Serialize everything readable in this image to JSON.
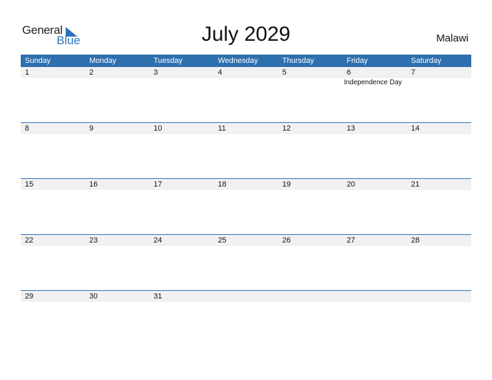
{
  "logo": {
    "general": "General",
    "blue": "Blue"
  },
  "title": "July 2029",
  "country": "Malawi",
  "colors": {
    "accent": "#2e6fae",
    "strip": "#f1f1f1",
    "logo_blue": "#2a73b8"
  },
  "weekdays": [
    "Sunday",
    "Monday",
    "Tuesday",
    "Wednesday",
    "Thursday",
    "Friday",
    "Saturday"
  ],
  "weeks": [
    [
      {
        "day": "1"
      },
      {
        "day": "2"
      },
      {
        "day": "3"
      },
      {
        "day": "4"
      },
      {
        "day": "5"
      },
      {
        "day": "6",
        "holiday": "Independence Day"
      },
      {
        "day": "7"
      }
    ],
    [
      {
        "day": "8"
      },
      {
        "day": "9"
      },
      {
        "day": "10"
      },
      {
        "day": "11"
      },
      {
        "day": "12"
      },
      {
        "day": "13"
      },
      {
        "day": "14"
      }
    ],
    [
      {
        "day": "15"
      },
      {
        "day": "16"
      },
      {
        "day": "17"
      },
      {
        "day": "18"
      },
      {
        "day": "19"
      },
      {
        "day": "20"
      },
      {
        "day": "21"
      }
    ],
    [
      {
        "day": "22"
      },
      {
        "day": "23"
      },
      {
        "day": "24"
      },
      {
        "day": "25"
      },
      {
        "day": "26"
      },
      {
        "day": "27"
      },
      {
        "day": "28"
      }
    ],
    [
      {
        "day": "29"
      },
      {
        "day": "30"
      },
      {
        "day": "31"
      },
      {
        "day": ""
      },
      {
        "day": ""
      },
      {
        "day": ""
      },
      {
        "day": ""
      }
    ]
  ]
}
